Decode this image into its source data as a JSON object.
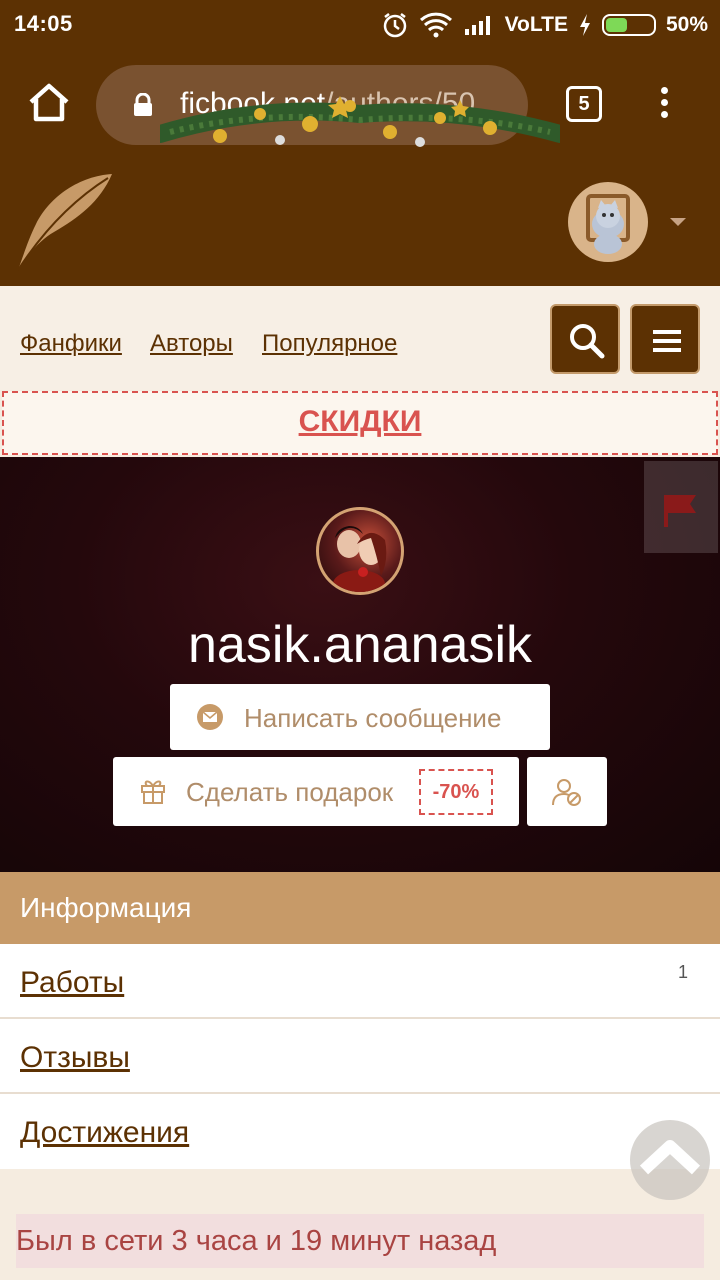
{
  "status_bar": {
    "time": "14:05",
    "network": "VoLTE",
    "battery": "50%",
    "battery_level": 0.5,
    "icons": [
      "alarm-icon",
      "wifi-icon",
      "signal-icon",
      "charging-icon",
      "battery-icon"
    ]
  },
  "browser": {
    "url_domain": "ficbook.net",
    "url_path": "/authors/50",
    "tab_count": "5",
    "icons": [
      "home-icon",
      "lock-icon",
      "tabs-icon",
      "more-icon"
    ]
  },
  "site": {
    "nav": [
      "Фанфики",
      "Авторы",
      "Популярное"
    ],
    "sales_label": "СКИДКИ",
    "icons": [
      "feather-logo",
      "user-avatar",
      "search-icon",
      "menu-icon"
    ]
  },
  "profile": {
    "username": "nasik.ananasik",
    "message_button": "Написать сообщение",
    "gift_button": "Сделать подарок",
    "gift_discount": "-70%",
    "icons": [
      "flag-icon",
      "envelope-icon",
      "gift-icon",
      "ignore-user-icon"
    ]
  },
  "info": {
    "title": "Информация",
    "items": [
      {
        "label": "Работы",
        "count": "1"
      },
      {
        "label": "Отзывы",
        "count": ""
      },
      {
        "label": "Достижения",
        "count": ""
      }
    ]
  },
  "last_seen": "Был в сети 3 часа и 19 минут назад",
  "colors": {
    "brand_brown": "#5c3103",
    "accent_tan": "#c79a68",
    "sale_red": "#d9534f"
  }
}
